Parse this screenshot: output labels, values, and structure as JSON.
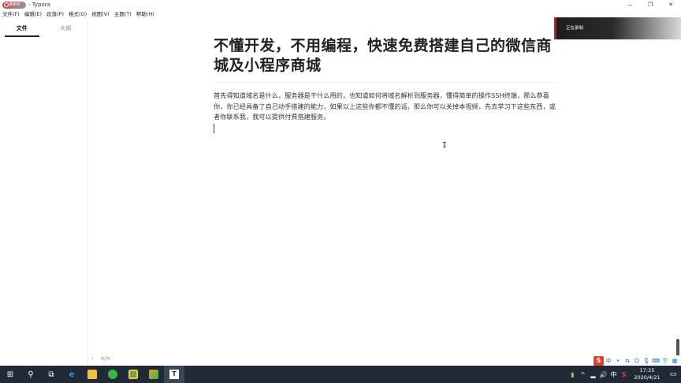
{
  "window": {
    "app_badge": "录制中",
    "title": "- Typora",
    "minimize": "—",
    "maximize": "❐",
    "close": "✕"
  },
  "menu": [
    "文件(F)",
    "编辑(E)",
    "段落(P)",
    "格式(O)",
    "视图(V)",
    "主题(T)",
    "帮助(H)"
  ],
  "sidebar": {
    "tabs": [
      {
        "label": "文件",
        "active": true
      },
      {
        "label": "大纲",
        "active": false
      }
    ],
    "footer_back": "‹",
    "footer_source": "</>"
  },
  "recording": {
    "label": "正在录制"
  },
  "document": {
    "title": "不懂开发，不用编程，快速免费搭建自己的微信商城及小程序商城",
    "paragraph": "首先得知道域名是什么，服务器是干什么用的，也知道如何将域名解析到服务器，懂得简单的操作SSH终端，那么恭喜你，你已经具备了自己动手搭建的能力，如果以上这些你都不懂的话，那么你可以关掉本视频，先去学习下这些东西，或者你联系我，我可以提供付费搭建服务。"
  },
  "ime": {
    "logo": "S",
    "items": [
      "中",
      "•",
      "⇆",
      "☺",
      "🎙",
      "⌨",
      "👕",
      "▦"
    ]
  },
  "taskbar": {
    "icons": [
      {
        "name": "windows-start-icon",
        "glyph": "⊞",
        "color": "#ffffff"
      },
      {
        "name": "search-icon",
        "glyph": "⚲",
        "color": "#ffffff"
      },
      {
        "name": "task-view-icon",
        "glyph": "⧉",
        "color": "#ffffff"
      },
      {
        "name": "edge-browser-icon",
        "glyph": "e",
        "color": "#3c8fe0"
      },
      {
        "name": "file-explorer-icon",
        "glyph": "",
        "color": "#f0c040"
      },
      {
        "name": "wechat-icon",
        "glyph": "",
        "color": "#3bb54a"
      },
      {
        "name": "app-green-icon",
        "glyph": "",
        "color": "#6aa84f"
      },
      {
        "name": "app-image-icon",
        "glyph": "",
        "color": "#e0a030"
      },
      {
        "name": "typora-icon",
        "glyph": "T",
        "color": "#ffffff"
      }
    ],
    "tray": [
      "▮",
      "^",
      "▂",
      "🔊",
      "中",
      "S"
    ],
    "time": "17:25",
    "date": "2020/4/21",
    "notification": "▭"
  }
}
